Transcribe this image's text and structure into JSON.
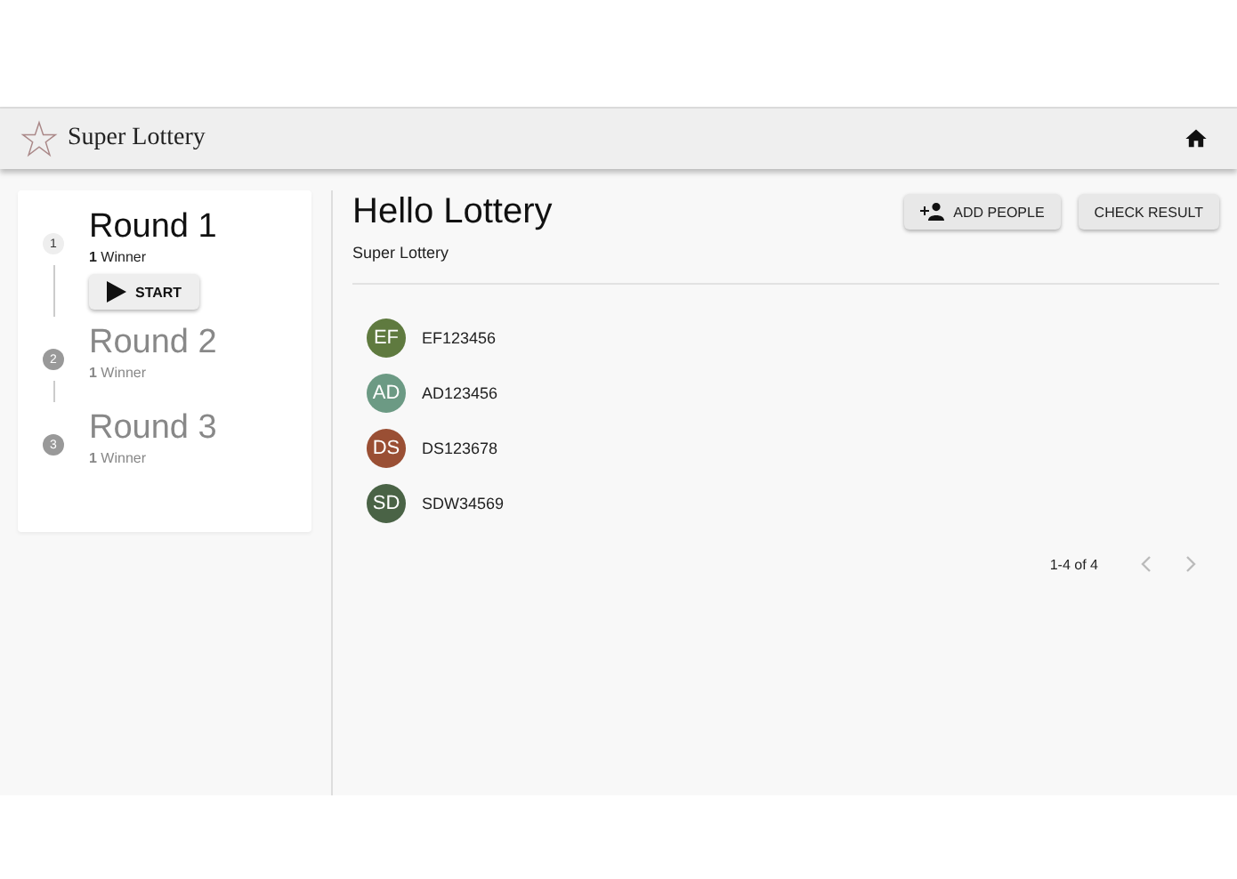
{
  "app_bar": {
    "title": "Super Lottery"
  },
  "rounds": [
    {
      "step": "1",
      "title": "Round 1",
      "count": "1",
      "count_label": "Winner",
      "selected": true,
      "action": "START"
    },
    {
      "step": "2",
      "title": "Round 2",
      "count": "1",
      "count_label": "Winner",
      "selected": false
    },
    {
      "step": "3",
      "title": "Round 3",
      "count": "1",
      "count_label": "Winner",
      "selected": false
    }
  ],
  "main": {
    "title": "Hello Lottery",
    "subtitle": "Super Lottery",
    "buttons": [
      {
        "kind": "add",
        "label": "ADD PEOPLE"
      },
      {
        "kind": "plain",
        "label": "CHECK RESULT"
      }
    ]
  },
  "people": [
    {
      "initials": "EF",
      "id": "EF123456",
      "color": "#5f7a3f"
    },
    {
      "initials": "AD",
      "id": "AD123456",
      "color": "#6c9a84"
    },
    {
      "initials": "DS",
      "id": "DS123678",
      "color": "#9a4f34"
    },
    {
      "initials": "SD",
      "id": "SDW34569",
      "color": "#4a6346"
    }
  ],
  "pagination": {
    "range": "1-4 of 4",
    "prev_disabled": true,
    "next_disabled": true
  }
}
